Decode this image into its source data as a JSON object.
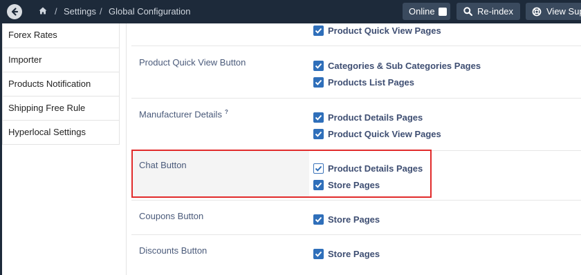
{
  "topbar": {
    "breadcrumb": [
      "Settings",
      "Global Configuration"
    ],
    "separator": "/",
    "buttons": {
      "online_label": "Online",
      "reindex_label": "Re-index",
      "view_label": "View Sup"
    }
  },
  "sidebar": {
    "items": [
      {
        "label": "Forex Rates"
      },
      {
        "label": "Importer"
      },
      {
        "label": "Products Notification"
      },
      {
        "label": "Shipping Free Rule"
      },
      {
        "label": "Hyperlocal Settings"
      }
    ]
  },
  "settings": {
    "top_option": "Product Quick View Pages",
    "rows": [
      {
        "label": "Product Quick View Button",
        "options": [
          "Categories & Sub Categories Pages",
          "Products List Pages"
        ]
      },
      {
        "label": "Manufacturer Details",
        "help": "?",
        "options": [
          "Product Details Pages",
          "Product Quick View Pages"
        ]
      },
      {
        "label": "Chat Button",
        "options": [
          "Product Details Pages",
          "Store Pages"
        ]
      },
      {
        "label": "Coupons Button",
        "options": [
          "Store Pages"
        ]
      },
      {
        "label": "Discounts Button",
        "options": [
          "Store Pages"
        ]
      }
    ]
  },
  "colors": {
    "topbar_bg": "#1d2a3a",
    "checkbox_accent": "#2f6fba",
    "highlight_border": "#e12a2a"
  }
}
